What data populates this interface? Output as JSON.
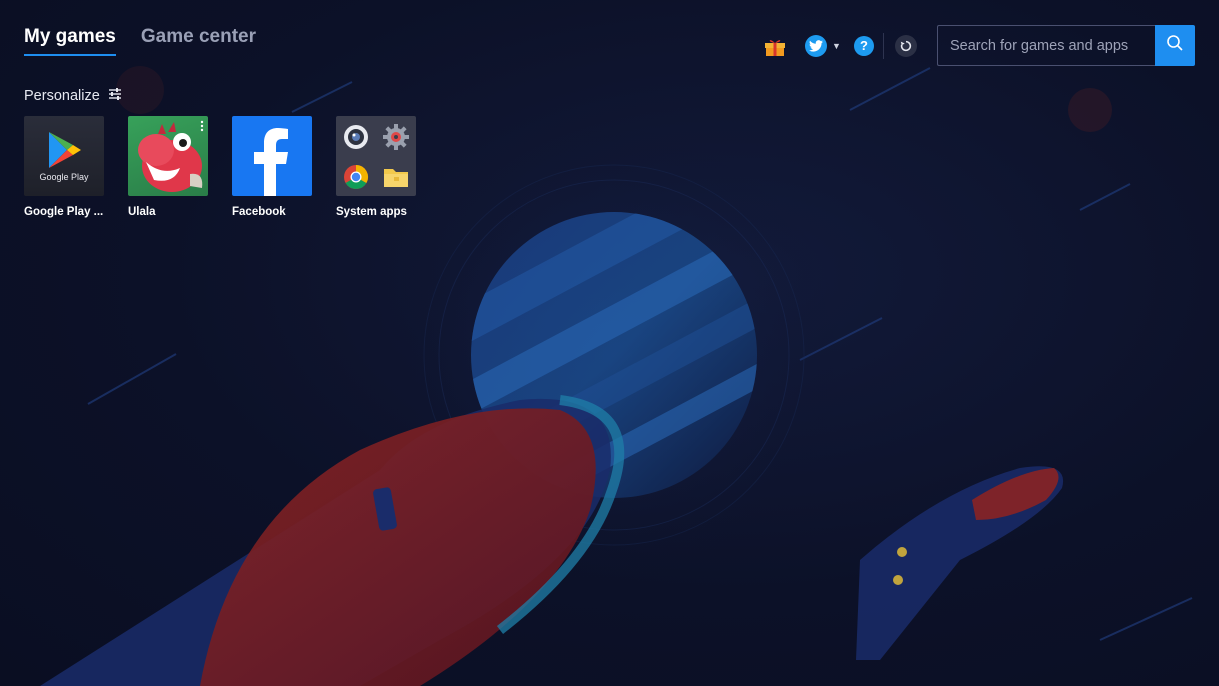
{
  "tabs": {
    "my_games": "My games",
    "game_center": "Game center"
  },
  "header": {
    "icons": [
      "gift-icon",
      "twitter-icon",
      "chevron-down-icon",
      "help-icon",
      "refresh-icon"
    ],
    "help_glyph": "?"
  },
  "search": {
    "placeholder": "Search for games and apps",
    "value": ""
  },
  "personalize": {
    "label": "Personalize",
    "icon": "sliders-icon"
  },
  "apps": [
    {
      "label": "Google Play ...",
      "tile_text": "Google Play",
      "icon": "google-play-icon"
    },
    {
      "label": "Ulala",
      "icon": "ulala-dinosaur-icon"
    },
    {
      "label": "Facebook",
      "icon": "facebook-icon"
    },
    {
      "label": "System apps",
      "icon": "system-apps-folder-icon"
    }
  ],
  "colors": {
    "accent": "#1e8ef0",
    "background": "#0d1229",
    "twitter": "#1d9bf0",
    "facebook": "#1877f2"
  }
}
